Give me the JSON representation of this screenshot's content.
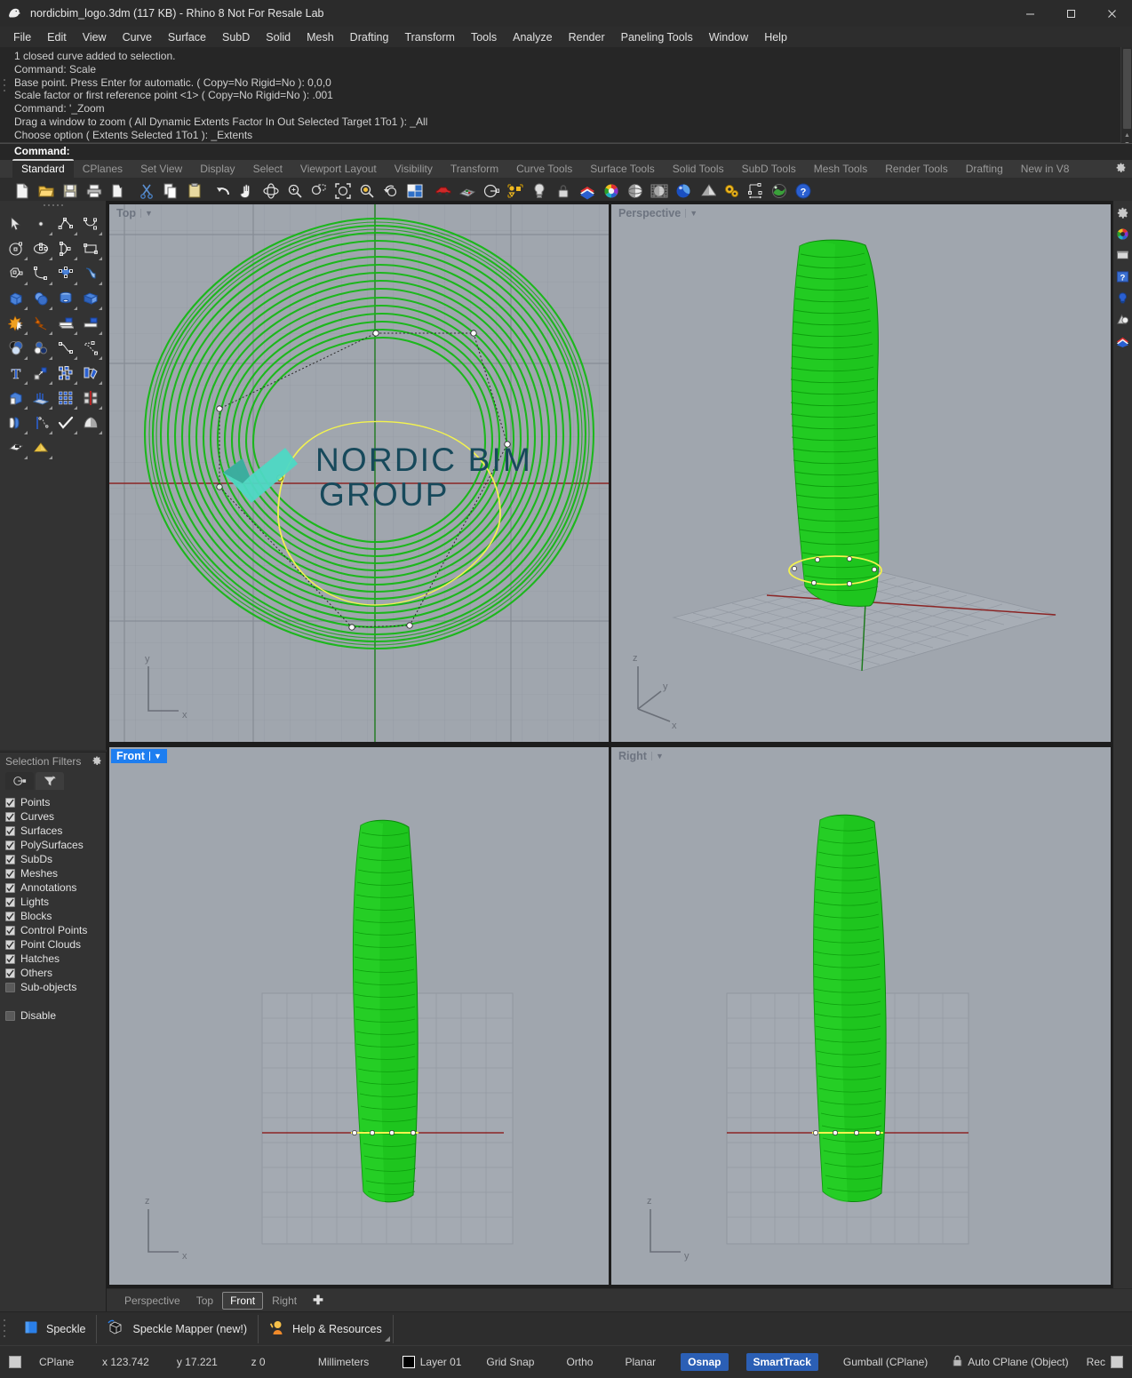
{
  "window": {
    "title": "nordicbim_logo.3dm (117 KB) - Rhino 8 Not For Resale Lab",
    "app_icon": "rhino-logo-icon",
    "minimize": "─",
    "maximize": "☐",
    "close": "✕"
  },
  "menubar": {
    "items": [
      "File",
      "Edit",
      "View",
      "Curve",
      "Surface",
      "SubD",
      "Solid",
      "Mesh",
      "Drafting",
      "Transform",
      "Tools",
      "Analyze",
      "Render",
      "Paneling Tools",
      "Window",
      "Help"
    ]
  },
  "command_history": {
    "lines": [
      "1 closed curve added to selection.",
      "Command: Scale",
      "Base point. Press Enter for automatic. ( Copy=No  Rigid=No ): 0,0,0",
      "Scale factor or first reference point <1> ( Copy=No  Rigid=No ): .001",
      "Command: '_Zoom",
      "Drag a window to zoom ( All  Dynamic  Extents  Factor  In  Out  Selected  Target  1To1 ): _All",
      "Choose option ( Extents  Selected  1To1 ): _Extents"
    ],
    "prompt": "Command:"
  },
  "toolbar_tabs": {
    "items": [
      "Standard",
      "CPlanes",
      "Set View",
      "Display",
      "Select",
      "Viewport Layout",
      "Visibility",
      "Transform",
      "Curve Tools",
      "Surface Tools",
      "Solid Tools",
      "SubD Tools",
      "Mesh Tools",
      "Render Tools",
      "Drafting",
      "New in V8"
    ],
    "active": "Standard",
    "settings_icon": "gear-icon"
  },
  "toolbar_icons": [
    "new-file-icon",
    "open-folder-icon",
    "save-icon",
    "print-icon",
    "save-as-icon",
    "cut-scissors-icon",
    "copy-icon",
    "paste-icon",
    "undo-icon",
    "pan-hand-icon",
    "rotate-view-icon",
    "zoom-icon",
    "zoom-window-icon",
    "zoom-extents-icon",
    "zoom-selected-icon",
    "undo-view-icon",
    "viewport-layout-icon",
    "car-render-icon",
    "grid-plane-icon",
    "cplane-origin-icon",
    "object-snap-icon",
    "light-bulb-icon",
    "lock-icon",
    "layers-icon",
    "color-wheel-icon",
    "shaded-sphere-icon",
    "ghosted-sphere-icon",
    "rendered-sphere-icon",
    "material-cone-icon",
    "gears-icon",
    "dimension-icon",
    "environment-icon",
    "help-icon"
  ],
  "left_palette": {
    "tools": [
      "select-arrow-icon",
      "point-icon",
      "polyline-icon",
      "curve-icon",
      "circle-icon",
      "ellipse-icon",
      "arc-icon",
      "rectangle-icon",
      "polygon-icon",
      "fillet-curve-icon",
      "surface-cp-icon",
      "sweep-surface-icon",
      "box-icon",
      "sphere-icon",
      "cylinder-icon",
      "surface-grid-icon",
      "explode-icon",
      "boolean-split-icon",
      "extrude-icon",
      "extrude-crv-icon",
      "boolean-union-icon",
      "boolean-difference-icon",
      "offset-curve-icon",
      "offset-dashed-icon",
      "text-icon",
      "scale-icon",
      "array-icon",
      "rotate-icon",
      "cplane-box-icon",
      "loft-icon",
      "array-grid-icon",
      "mirror-icon",
      "unroll-icon",
      "flow-along-curve-icon",
      "check-icon",
      "blend-surface-icon",
      "picture-frame-icon",
      "render-light-icon"
    ]
  },
  "selection_filters": {
    "title": "Selection Filters",
    "settings_icon": "gear-icon",
    "tabs": [
      "layers-tab-icon",
      "filter-funnel-icon"
    ],
    "active_tab": 1,
    "items": [
      {
        "label": "Points",
        "checked": true
      },
      {
        "label": "Curves",
        "checked": true
      },
      {
        "label": "Surfaces",
        "checked": true
      },
      {
        "label": "PolySurfaces",
        "checked": true
      },
      {
        "label": "SubDs",
        "checked": true
      },
      {
        "label": "Meshes",
        "checked": true
      },
      {
        "label": "Annotations",
        "checked": true
      },
      {
        "label": "Lights",
        "checked": true
      },
      {
        "label": "Blocks",
        "checked": true
      },
      {
        "label": "Control Points",
        "checked": true
      },
      {
        "label": "Point Clouds",
        "checked": true
      },
      {
        "label": "Hatches",
        "checked": true
      },
      {
        "label": "Others",
        "checked": true
      },
      {
        "label": "Sub-objects",
        "checked": false
      }
    ],
    "disable": {
      "label": "Disable",
      "checked": false
    }
  },
  "viewports": [
    {
      "name": "Top",
      "active": false,
      "axes": [
        "y",
        "x"
      ],
      "axis_style": "2d"
    },
    {
      "name": "Perspective",
      "active": false,
      "axes": [
        "z",
        "y",
        "x"
      ],
      "axis_style": "3d"
    },
    {
      "name": "Front",
      "active": true,
      "axes": [
        "z",
        "x"
      ],
      "axis_style": "2d"
    },
    {
      "name": "Right",
      "active": false,
      "axes": [
        "z",
        "y"
      ],
      "axis_style": "2d"
    }
  ],
  "watermark": {
    "line1": "NORDIC BIM",
    "line2": "GROUP",
    "color": "#17495b",
    "logo_color_light": "#4ed8c4",
    "logo_color_dark": "#3aa99a",
    "logo_icon": "nordicbim-check-logo"
  },
  "viewport_tabs": {
    "items": [
      "Perspective",
      "Top",
      "Front",
      "Right"
    ],
    "active": "Front",
    "add_label": "✚"
  },
  "plugin_bar": {
    "items": [
      {
        "label": "Speckle",
        "icon": "speckle-cube-icon"
      },
      {
        "label": "Speckle Mapper (new!)",
        "icon": "speckle-mapper-icon"
      },
      {
        "label": "Help & Resources",
        "icon": "help-person-icon"
      }
    ]
  },
  "statusbar": {
    "cplane_icon": "cplane-icon",
    "cplane": "CPlane",
    "x": "x 123.742",
    "y": "y 17.221",
    "z": "z 0",
    "units": "Millimeters",
    "layer": "Layer 01",
    "layer_color": "#000000",
    "toggles": [
      {
        "label": "Grid Snap",
        "on": false
      },
      {
        "label": "Ortho",
        "on": false
      },
      {
        "label": "Planar",
        "on": false
      },
      {
        "label": "Osnap",
        "on": true
      },
      {
        "label": "SmartTrack",
        "on": true
      },
      {
        "label": "Gumball (CPlane)",
        "on": false
      }
    ],
    "lock_icon": "padlock-icon",
    "auto_cplane": "Auto CPlane (Object)",
    "record_label": "Rec"
  },
  "colors": {
    "viewport_bg": "#a0a6ae",
    "grid_line": "#8f959e",
    "grid_major": "#7d838c",
    "model_green": "#1fc41f",
    "model_green_dark": "#0e9a17",
    "selection_yellow": "#f2f24a",
    "x_axis_red": "#8b2020",
    "y_axis_green": "#1a7a1a",
    "accent_blue": "#1e7ef0"
  }
}
